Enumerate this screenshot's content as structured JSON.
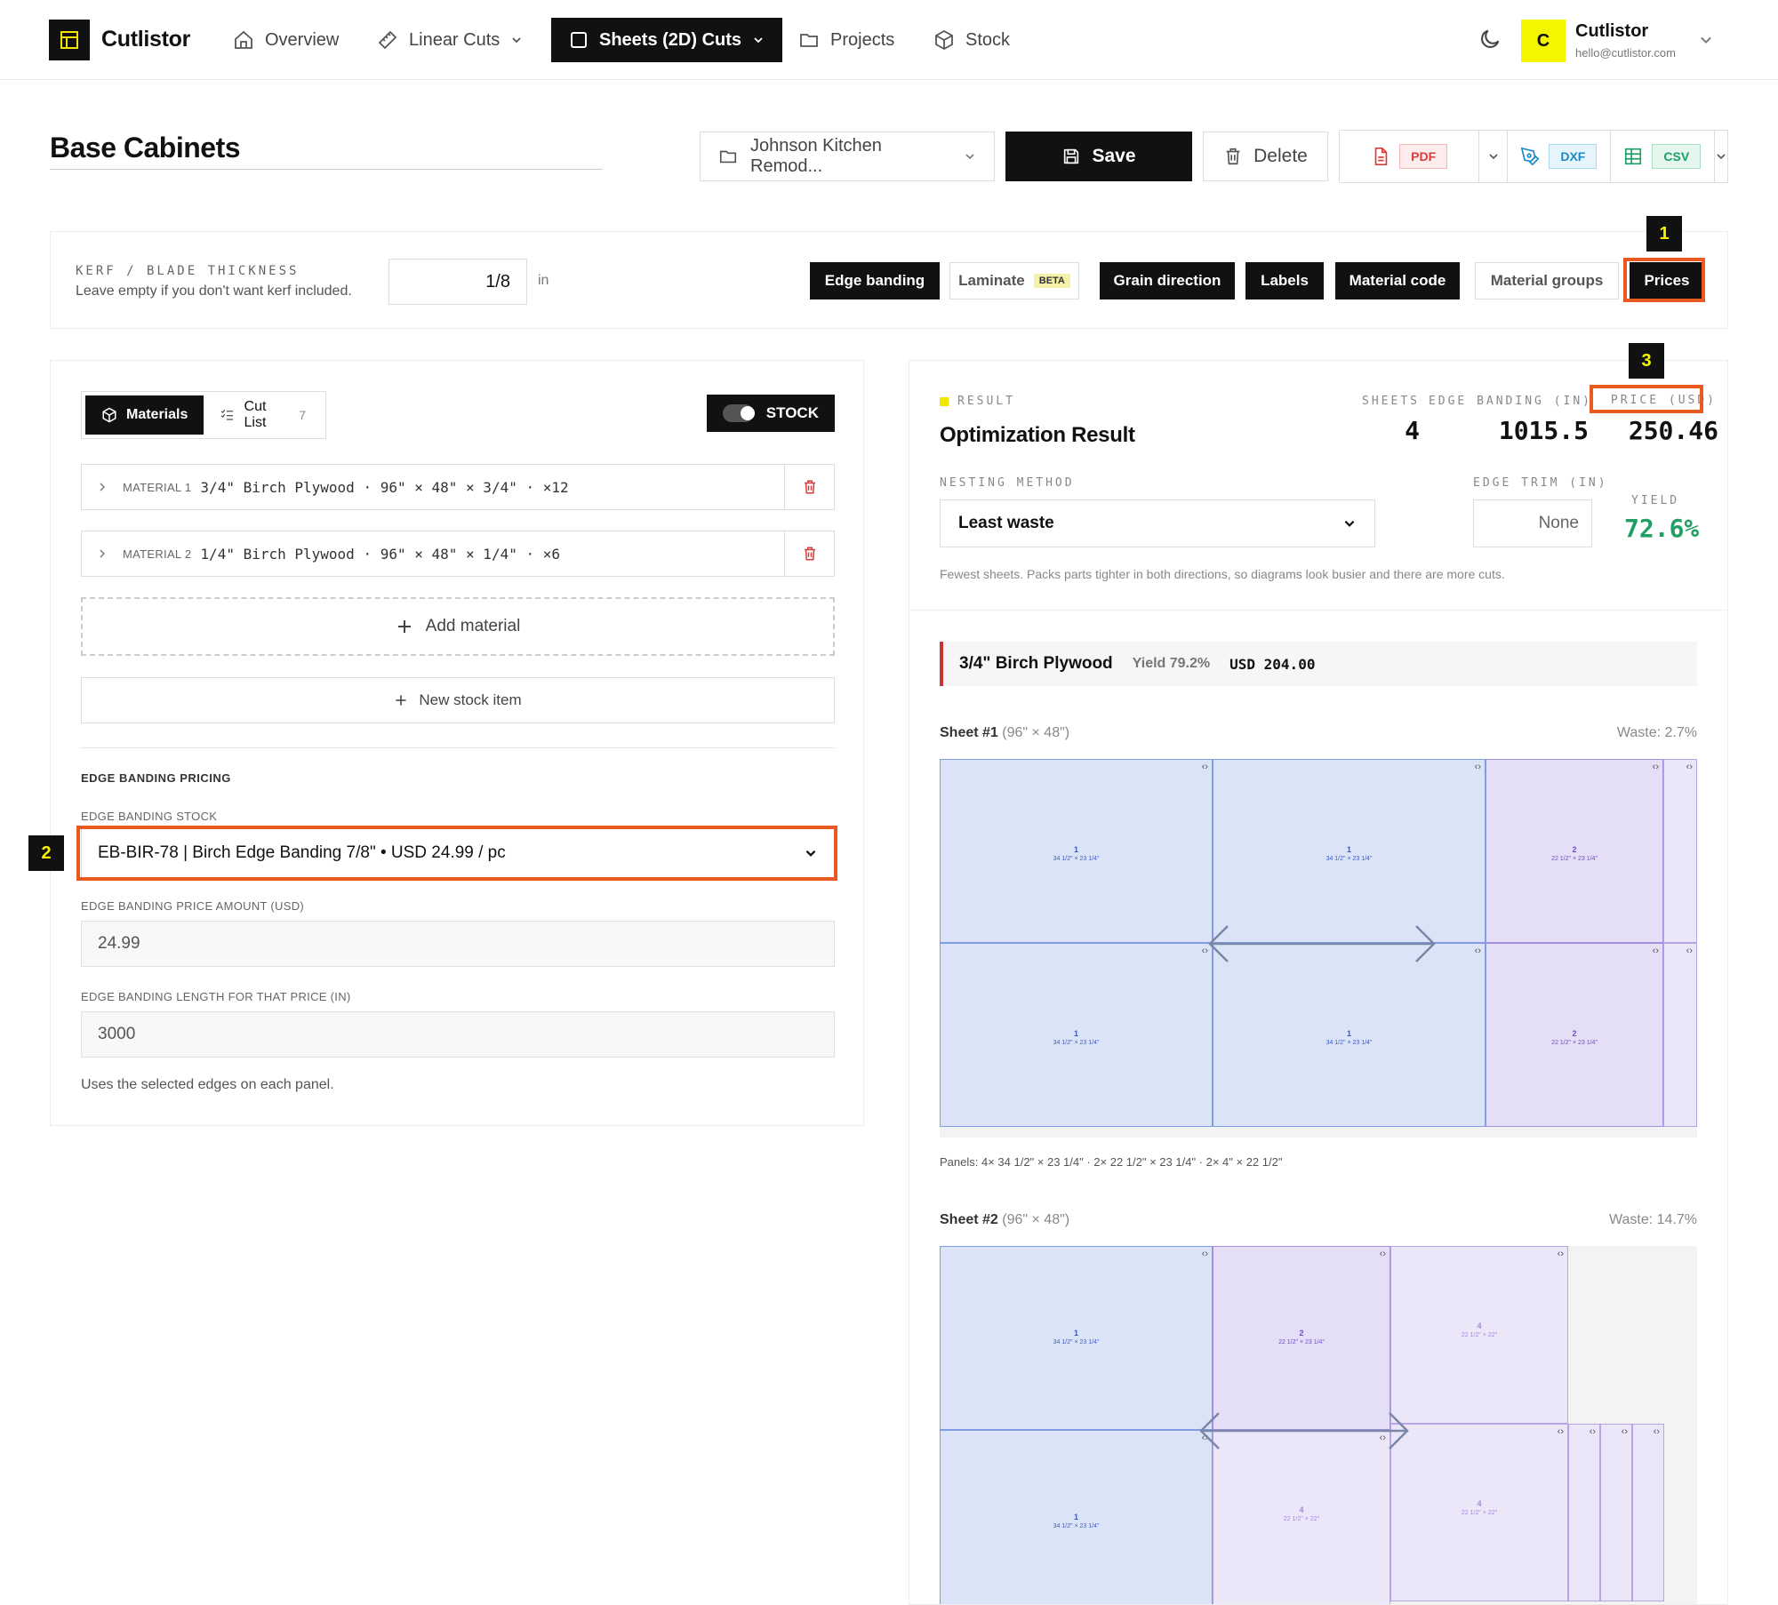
{
  "app": {
    "name": "Cutlistor"
  },
  "nav": {
    "overview": "Overview",
    "linear_cuts": "Linear Cuts",
    "sheets_cuts": "Sheets (2D) Cuts",
    "projects": "Projects",
    "stock": "Stock"
  },
  "user": {
    "initial": "C",
    "name": "Cutlistor",
    "email": "hello@cutlistor.com"
  },
  "page": {
    "title": "Base Cabinets"
  },
  "toolbar": {
    "project": "Johnson Kitchen Remod...",
    "save": "Save",
    "delete": "Delete",
    "pdf": "PDF",
    "dxf": "DXF",
    "csv": "CSV"
  },
  "kerf": {
    "label": "KERF / BLADE THICKNESS",
    "help": "Leave empty if you don't want kerf included.",
    "value": "1/8",
    "unit": "in"
  },
  "options": {
    "edge_banding": "Edge banding",
    "laminate": "Laminate",
    "beta": "BETA",
    "grain_direction": "Grain direction",
    "labels": "Labels",
    "material_code": "Material code",
    "material_groups": "Material groups",
    "prices": "Prices"
  },
  "markers": {
    "m1": "1",
    "m2": "2",
    "m3": "3"
  },
  "left": {
    "tab_materials": "Materials",
    "tab_cutlist": "Cut List",
    "cutlist_count": "7",
    "stock_toggle": "STOCK",
    "materials": [
      {
        "label": "MATERIAL 1",
        "desc": "3/4\" Birch Plywood · 96\" × 48\" × 3/4\" · ×12"
      },
      {
        "label": "MATERIAL 2",
        "desc": "1/4\" Birch Plywood · 96\" × 48\" × 1/4\" · ×6"
      }
    ],
    "add_material": "Add material",
    "new_stock": "New stock item",
    "eb_section": "EDGE BANDING PRICING",
    "eb_stock_label": "EDGE BANDING STOCK",
    "eb_stock_value": "EB-BIR-78 | Birch Edge Banding 7/8\" • USD 24.99 / pc",
    "eb_price_label": "EDGE BANDING PRICE AMOUNT (USD)",
    "eb_price_value": "24.99",
    "eb_length_label": "EDGE BANDING LENGTH FOR THAT PRICE (IN)",
    "eb_length_value": "3000",
    "help": "Uses the selected edges on each panel."
  },
  "result": {
    "label": "RESULT",
    "title": "Optimization Result",
    "sheets_label": "SHEETS",
    "sheets_value": "4",
    "eb_label": "EDGE BANDING (IN)",
    "eb_value": "1015.5",
    "price_label": "PRICE (USD)",
    "price_value": "250.46",
    "nesting_label": "NESTING METHOD",
    "nesting_value": "Least waste",
    "trim_label": "EDGE TRIM (IN)",
    "trim_value": "None",
    "yield_label": "YIELD",
    "yield_value": "72.6%",
    "nesting_help": "Fewest sheets. Packs parts tighter in both directions, so diagrams look busier and there are more cuts.",
    "material_name": "3/4\" Birch Plywood",
    "material_yield": "Yield 79.2%",
    "material_price": "USD 204.00",
    "sheet1_title": "Sheet #1",
    "sheet1_size": "(96\" × 48\")",
    "sheet1_waste": "Waste: 2.7%",
    "sheet1_panels": "Panels: 4× 34 1/2\" × 23 1/4\" · 2× 22 1/2\" × 23 1/4\" · 2× 4\" × 22 1/2\"",
    "sheet2_title": "Sheet #2",
    "sheet2_size": "(96\" × 48\")",
    "sheet2_waste": "Waste: 14.7%",
    "panel_a_num": "1",
    "panel_a_dim": "34 1/2\" × 23 1/4\"",
    "panel_b_num": "2",
    "panel_b_dim": "22 1/2\" × 23 1/4\"",
    "panel_c_num": "4",
    "panel_c_dim": "22 1/2\" × 22\""
  },
  "colors": {
    "accent": "#111111",
    "highlight": "#e85a1f",
    "marker_text": "#f5f500",
    "yield_green": "#1f9f63"
  }
}
